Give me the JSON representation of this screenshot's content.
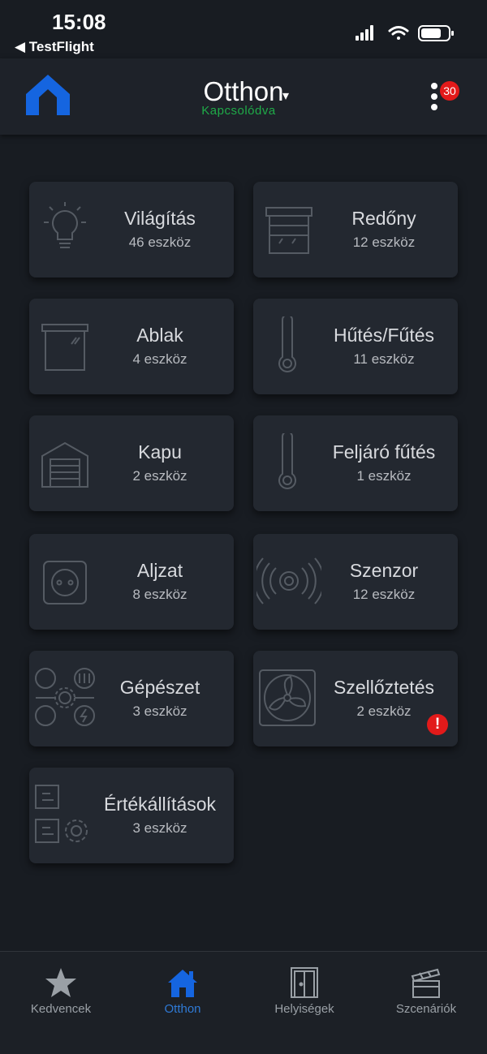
{
  "status_bar": {
    "time": "15:08",
    "back_app": "◀ TestFlight"
  },
  "header": {
    "title": "Otthon",
    "dropdown_glyph": "▾",
    "connection_status": "Kapcsolódva",
    "notification_count": "30"
  },
  "colors": {
    "accent": "#1565e0",
    "connected": "#1faa48",
    "badge": "#e21a1a",
    "card": "#232830",
    "background": "#181c22"
  },
  "categories": [
    {
      "label": "Világítás",
      "count": "46 eszköz",
      "icon": "lightbulb-icon"
    },
    {
      "label": "Redőny",
      "count": "12 eszköz",
      "icon": "shutter-icon"
    },
    {
      "label": "Ablak",
      "count": "4 eszköz",
      "icon": "window-icon"
    },
    {
      "label": "Hűtés/Fűtés",
      "count": "11 eszköz",
      "icon": "thermometer-icon"
    },
    {
      "label": "Kapu",
      "count": "2 eszköz",
      "icon": "garage-door-icon"
    },
    {
      "label": "Feljáró fűtés",
      "count": "1 eszköz",
      "icon": "thermometer-icon"
    },
    {
      "label": "Aljzat",
      "count": "8 eszköz",
      "icon": "socket-icon"
    },
    {
      "label": "Szenzor",
      "count": "12 eszköz",
      "icon": "sensor-icon"
    },
    {
      "label": "Gépészet",
      "count": "3 eszköz",
      "icon": "machinery-icon"
    },
    {
      "label": "Szellőztetés",
      "count": "2 eszköz",
      "icon": "fan-icon",
      "alert": "!"
    },
    {
      "label": "Értékállítások",
      "count": "3 eszköz",
      "icon": "settings-values-icon"
    }
  ],
  "tabs": [
    {
      "label": "Kedvencek",
      "icon": "star-icon",
      "active": false
    },
    {
      "label": "Otthon",
      "icon": "home-icon",
      "active": true
    },
    {
      "label": "Helyiségek",
      "icon": "door-icon",
      "active": false
    },
    {
      "label": "Szcenáriók",
      "icon": "clapperboard-icon",
      "active": false
    }
  ]
}
